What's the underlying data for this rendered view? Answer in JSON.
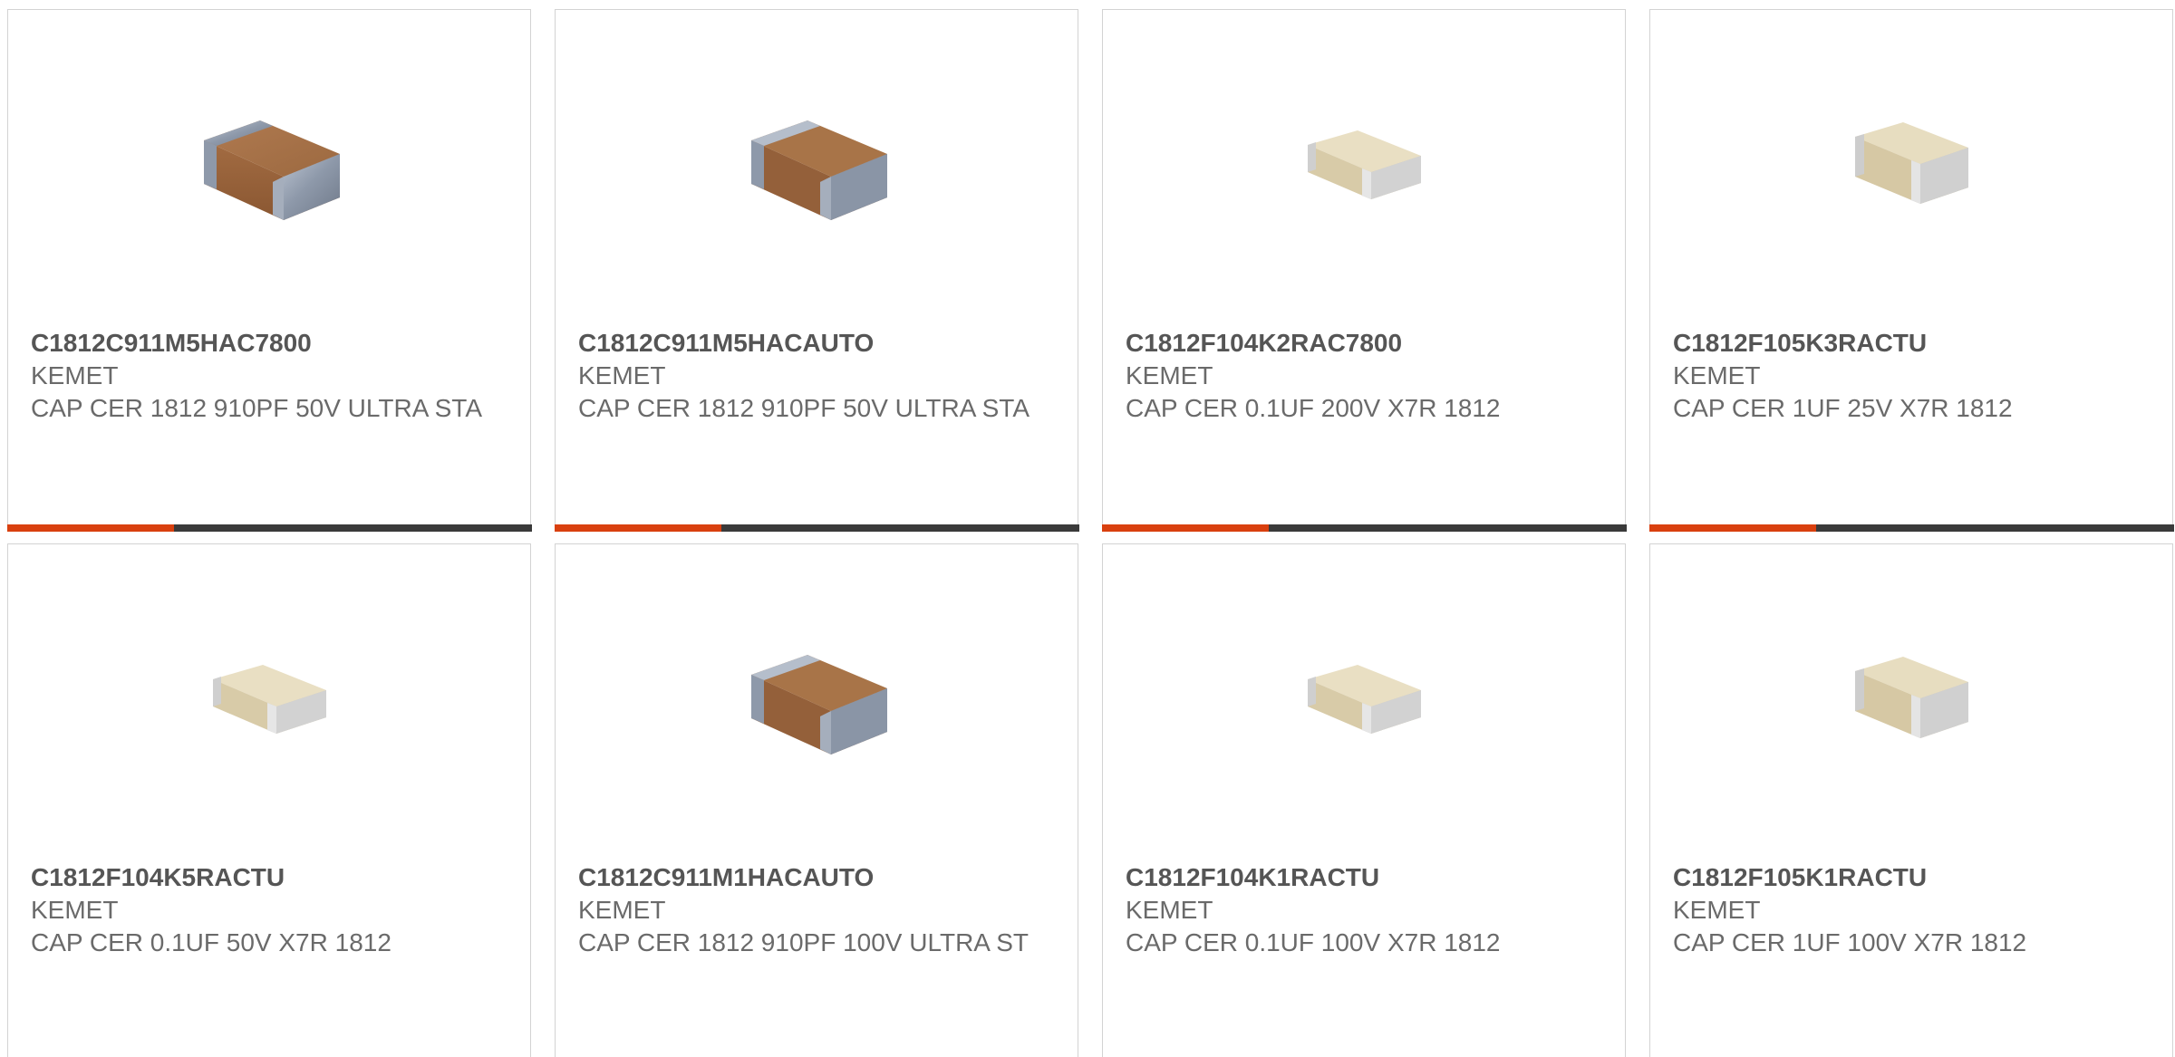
{
  "products": [
    {
      "part_number": "C1812C911M5HAC7800",
      "manufacturer": "KEMET",
      "description": "CAP CER 1812 910PF 50V ULTRA STA",
      "image_icon": "capacitor-brown-image"
    },
    {
      "part_number": "C1812C911M5HACAUTO",
      "manufacturer": "KEMET",
      "description": "CAP CER 1812 910PF 50V ULTRA STA",
      "image_icon": "capacitor-brown-image"
    },
    {
      "part_number": "C1812F104K2RAC7800",
      "manufacturer": "KEMET",
      "description": "CAP CER 0.1UF 200V X7R 1812",
      "image_icon": "capacitor-beige-image"
    },
    {
      "part_number": "C1812F105K3RACTU",
      "manufacturer": "KEMET",
      "description": "CAP CER 1UF 25V X7R 1812",
      "image_icon": "capacitor-beige-image"
    },
    {
      "part_number": "C1812F104K5RACTU",
      "manufacturer": "KEMET",
      "description": "CAP CER 0.1UF 50V X7R 1812",
      "image_icon": "capacitor-beige-image"
    },
    {
      "part_number": "C1812C911M1HACAUTO",
      "manufacturer": "KEMET",
      "description": "CAP CER 1812 910PF 100V ULTRA ST",
      "image_icon": "capacitor-brown-image"
    },
    {
      "part_number": "C1812F104K1RACTU",
      "manufacturer": "KEMET",
      "description": "CAP CER 0.1UF 100V X7R 1812",
      "image_icon": "capacitor-beige-image"
    },
    {
      "part_number": "C1812F105K1RACTU",
      "manufacturer": "KEMET",
      "description": "CAP CER 1UF 100V X7R 1812",
      "image_icon": "capacitor-beige-image"
    }
  ],
  "colors": {
    "accent": "#d9400f",
    "bar": "#3a3a3a",
    "border": "#d3d3d3",
    "text": "#6a6a6a",
    "part_number": "#555555"
  }
}
